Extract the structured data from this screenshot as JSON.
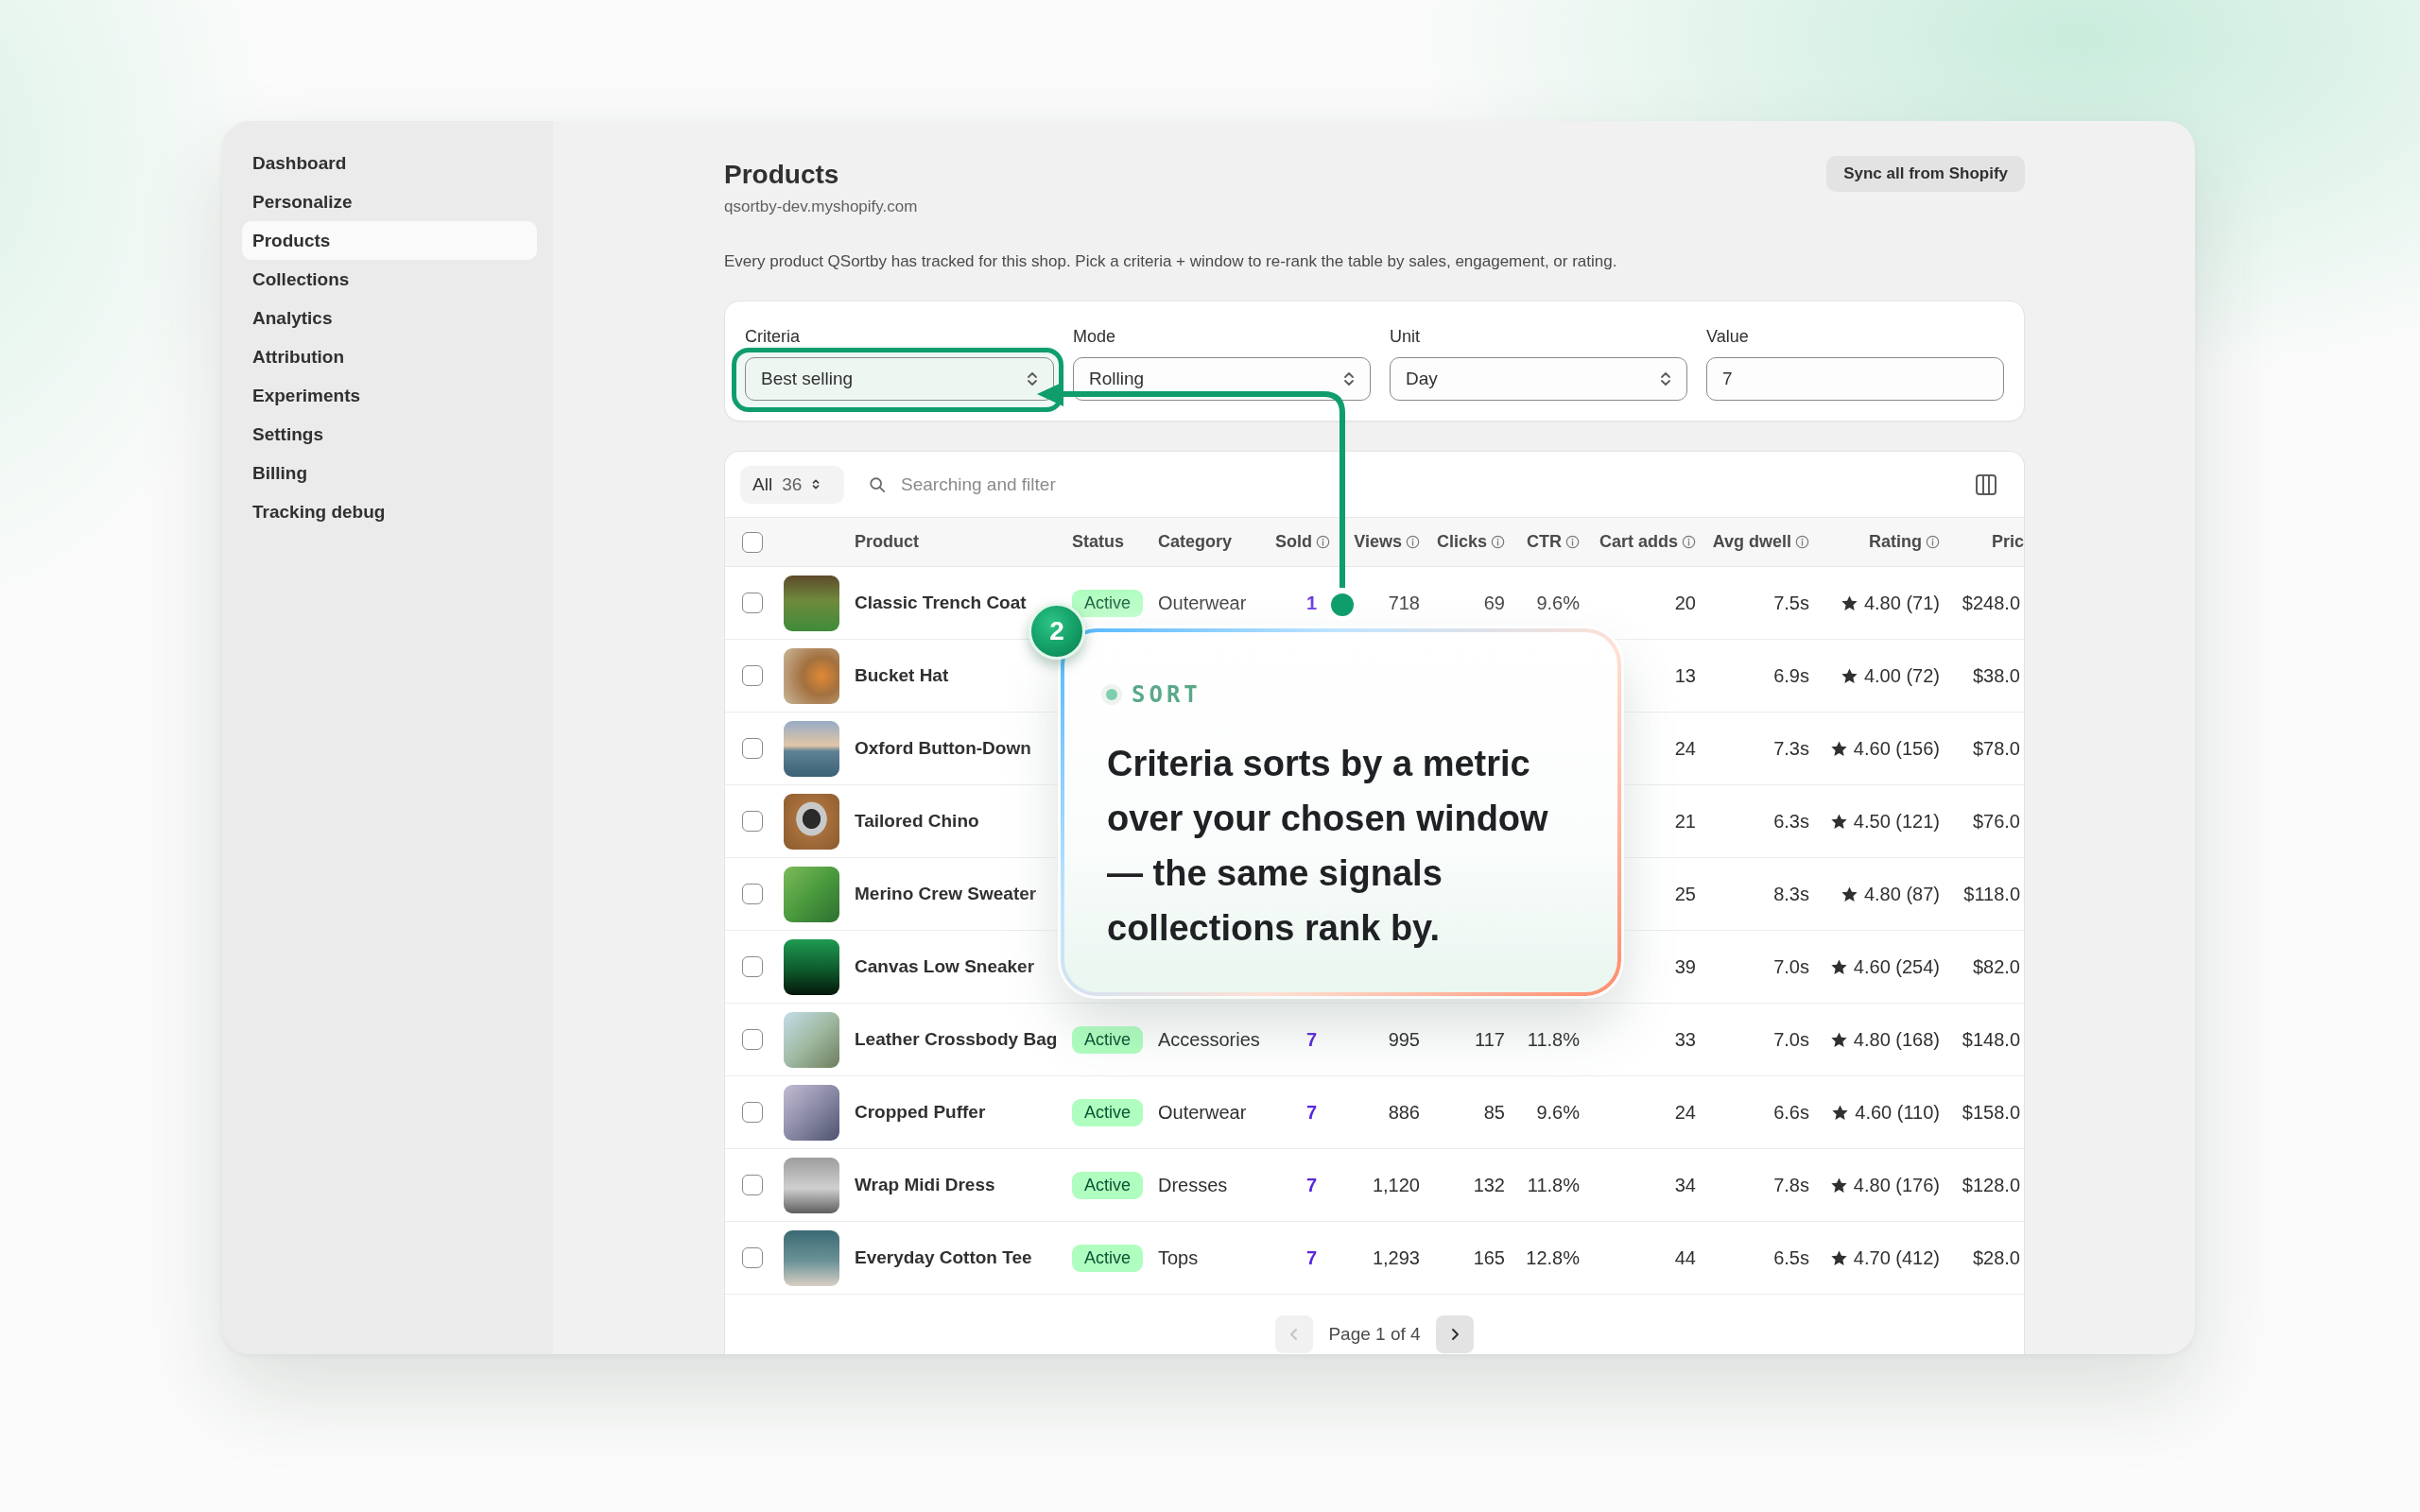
{
  "sidebar": {
    "items": [
      {
        "label": "Dashboard",
        "selected": false
      },
      {
        "label": "Personalize",
        "selected": false
      },
      {
        "label": "Products",
        "selected": true
      },
      {
        "label": "Collections",
        "selected": false
      },
      {
        "label": "Analytics",
        "selected": false
      },
      {
        "label": "Attribution",
        "selected": false
      },
      {
        "label": "Experiments",
        "selected": false
      },
      {
        "label": "Settings",
        "selected": false
      },
      {
        "label": "Billing",
        "selected": false
      },
      {
        "label": "Tracking debug",
        "selected": false
      }
    ]
  },
  "header": {
    "title": "Products",
    "subtitle": "qsortby-dev.myshopify.com",
    "action": "Sync all from Shopify",
    "description": "Every product QSortby has tracked for this shop. Pick a criteria + window to re-rank the table by sales, engagement, or rating."
  },
  "filters": [
    {
      "label": "Criteria",
      "kind": "select",
      "value": "Best selling",
      "highlighted": true
    },
    {
      "label": "Mode",
      "kind": "select",
      "value": "Rolling",
      "highlighted": false
    },
    {
      "label": "Unit",
      "kind": "select",
      "value": "Day",
      "highlighted": false
    },
    {
      "label": "Value",
      "kind": "input",
      "value": "7",
      "highlighted": false
    }
  ],
  "table": {
    "scope": {
      "label": "All",
      "count": "36"
    },
    "search": {
      "placeholder": "Searching and filter"
    },
    "header_checkbox": {
      "checked": false
    },
    "columns": [
      {
        "label": "Product",
        "kind": "product",
        "info": false
      },
      {
        "label": "Status",
        "kind": "status",
        "info": false
      },
      {
        "label": "Category",
        "kind": "text",
        "info": false
      },
      {
        "label": "Sold",
        "kind": "highlight",
        "info": true
      },
      {
        "label": "Views",
        "kind": "number",
        "info": true
      },
      {
        "label": "Clicks",
        "kind": "number",
        "info": true
      },
      {
        "label": "CTR",
        "kind": "number",
        "info": true
      },
      {
        "label": "Cart adds",
        "kind": "number",
        "info": true
      },
      {
        "label": "Avg dwell",
        "kind": "number",
        "info": true
      },
      {
        "label": "Rating",
        "kind": "rating",
        "info": true
      },
      {
        "label": "Pric",
        "kind": "number",
        "info": false
      }
    ],
    "rows": [
      {
        "checked": false,
        "cells": [
          "Classic Trench Coat",
          "Active",
          "Outerwear",
          "1",
          "718",
          "69",
          "9.6%",
          "20",
          "7.5s",
          "4.80 (71)",
          "$248.0"
        ]
      },
      {
        "checked": false,
        "cells": [
          "Bucket Hat",
          null,
          null,
          null,
          null,
          null,
          null,
          "13",
          "6.9s",
          "4.00 (72)",
          "$38.0"
        ]
      },
      {
        "checked": false,
        "cells": [
          "Oxford Button-Down",
          null,
          null,
          null,
          null,
          null,
          null,
          "24",
          "7.3s",
          "4.60 (156)",
          "$78.0"
        ]
      },
      {
        "checked": false,
        "cells": [
          "Tailored Chino",
          null,
          null,
          null,
          null,
          null,
          null,
          "21",
          "6.3s",
          "4.50 (121)",
          "$76.0"
        ]
      },
      {
        "checked": false,
        "cells": [
          "Merino Crew Sweater",
          null,
          null,
          null,
          null,
          null,
          null,
          "25",
          "8.3s",
          "4.80 (87)",
          "$118.0"
        ]
      },
      {
        "checked": false,
        "cells": [
          "Canvas Low Sneaker",
          null,
          null,
          null,
          null,
          null,
          null,
          "39",
          "7.0s",
          "4.60 (254)",
          "$82.0"
        ]
      },
      {
        "checked": false,
        "cells": [
          "Leather Crossbody Bag",
          "Active",
          "Accessories",
          "7",
          "995",
          "117",
          "11.8%",
          "33",
          "7.0s",
          "4.80 (168)",
          "$148.0"
        ]
      },
      {
        "checked": false,
        "cells": [
          "Cropped Puffer",
          "Active",
          "Outerwear",
          "7",
          "886",
          "85",
          "9.6%",
          "24",
          "6.6s",
          "4.60 (110)",
          "$158.0"
        ]
      },
      {
        "checked": false,
        "cells": [
          "Wrap Midi Dress",
          "Active",
          "Dresses",
          "7",
          "1,120",
          "132",
          "11.8%",
          "34",
          "7.8s",
          "4.80 (176)",
          "$128.0"
        ]
      },
      {
        "checked": false,
        "cells": [
          "Everyday Cotton Tee",
          "Active",
          "Tops",
          "7",
          "1,293",
          "165",
          "12.8%",
          "44",
          "6.5s",
          "4.70 (412)",
          "$28.0"
        ]
      }
    ]
  },
  "pagination": {
    "label": "Page 1 of 4",
    "previous": {
      "disabled": true
    },
    "next": {
      "disabled": false
    }
  },
  "annotation": {
    "step": "2",
    "kicker": "SORT",
    "text": "Criteria sorts by a metric over your chosen window — the same signals collections rank by."
  }
}
